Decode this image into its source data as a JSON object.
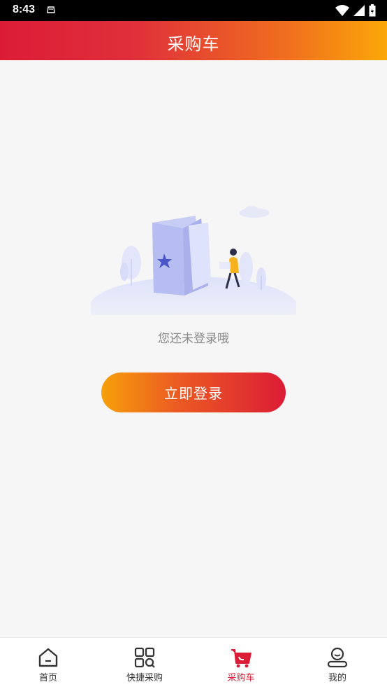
{
  "status_bar": {
    "time": "8:43"
  },
  "header": {
    "title": "采购车"
  },
  "empty_state": {
    "message": "您还未登录哦",
    "login_button": "立即登录"
  },
  "tabbar": {
    "items": [
      {
        "label": "首页",
        "icon": "home-icon"
      },
      {
        "label": "快捷采购",
        "icon": "quick-purchase-icon"
      },
      {
        "label": "采购车",
        "icon": "cart-icon",
        "active": true
      },
      {
        "label": "我的",
        "icon": "profile-icon"
      }
    ]
  },
  "colors": {
    "brand_red": "#dc1c36",
    "brand_orange": "#fba808",
    "background": "#f6f6f6"
  }
}
